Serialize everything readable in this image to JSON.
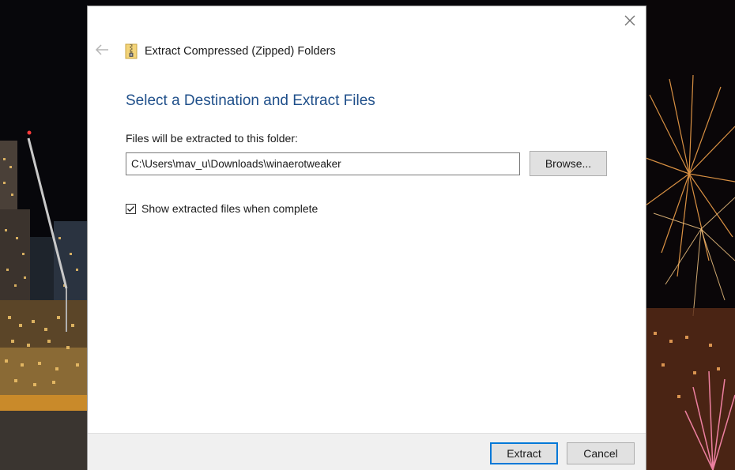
{
  "dialog": {
    "title": "Extract Compressed (Zipped) Folders",
    "heading": "Select a Destination and Extract Files",
    "destination_label": "Files will be extracted to this folder:",
    "destination_path": "C:\\Users\\mav_u\\Downloads\\winaerotweaker",
    "browse_label": "Browse...",
    "show_files_label": "Show extracted files when complete",
    "show_files_checked": true
  },
  "footer": {
    "extract_label": "Extract",
    "cancel_label": "Cancel"
  },
  "icons": {
    "back": "back-arrow-icon",
    "close": "close-icon",
    "app": "zip-folder-icon",
    "checkbox": "checkmark-icon"
  },
  "colors": {
    "heading": "#1f4f8a",
    "focus_border": "#0078d7",
    "button_face": "#e1e1e1",
    "footer_bg": "#f0f0f0"
  }
}
